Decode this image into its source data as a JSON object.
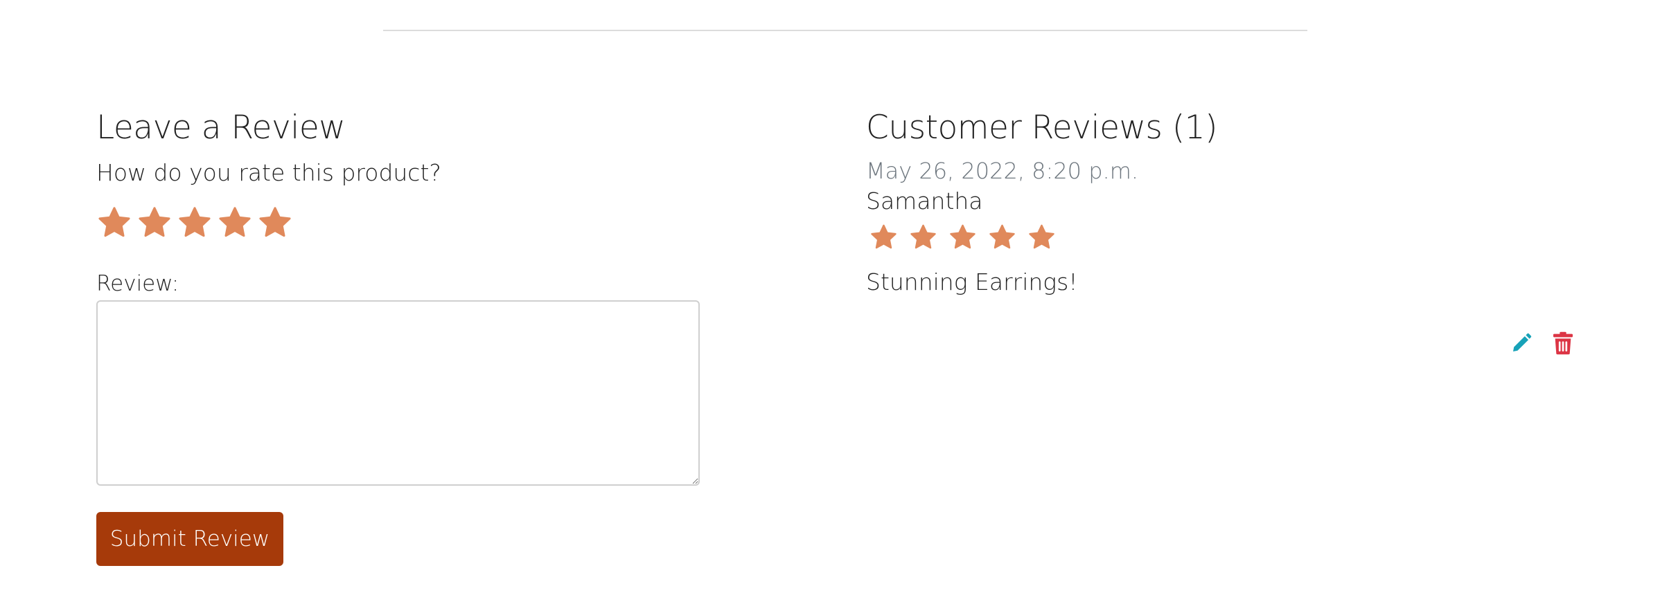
{
  "leave_review": {
    "title": "Leave a Review",
    "question": "How do you rate this product?",
    "rating_options": [
      1,
      2,
      3,
      4,
      5
    ],
    "review_label": "Review:",
    "review_value": "",
    "submit_label": "Submit Review"
  },
  "customer_reviews": {
    "title": "Customer Reviews (1)",
    "reviews": [
      {
        "date": "May 26, 2022, 8:20 p.m.",
        "author": "Samantha",
        "rating": 5,
        "rating_max": 5,
        "text": "Stunning Earrings!",
        "actions": [
          {
            "icon": "pencil-icon",
            "label": "edit"
          },
          {
            "icon": "trash-icon",
            "label": "delete"
          }
        ]
      }
    ]
  },
  "colors": {
    "star": "#e0895b",
    "button": "#a63a0a",
    "edit_icon": "#17a2b8",
    "delete_icon": "#dc3545",
    "muted_text": "#6c757d"
  }
}
